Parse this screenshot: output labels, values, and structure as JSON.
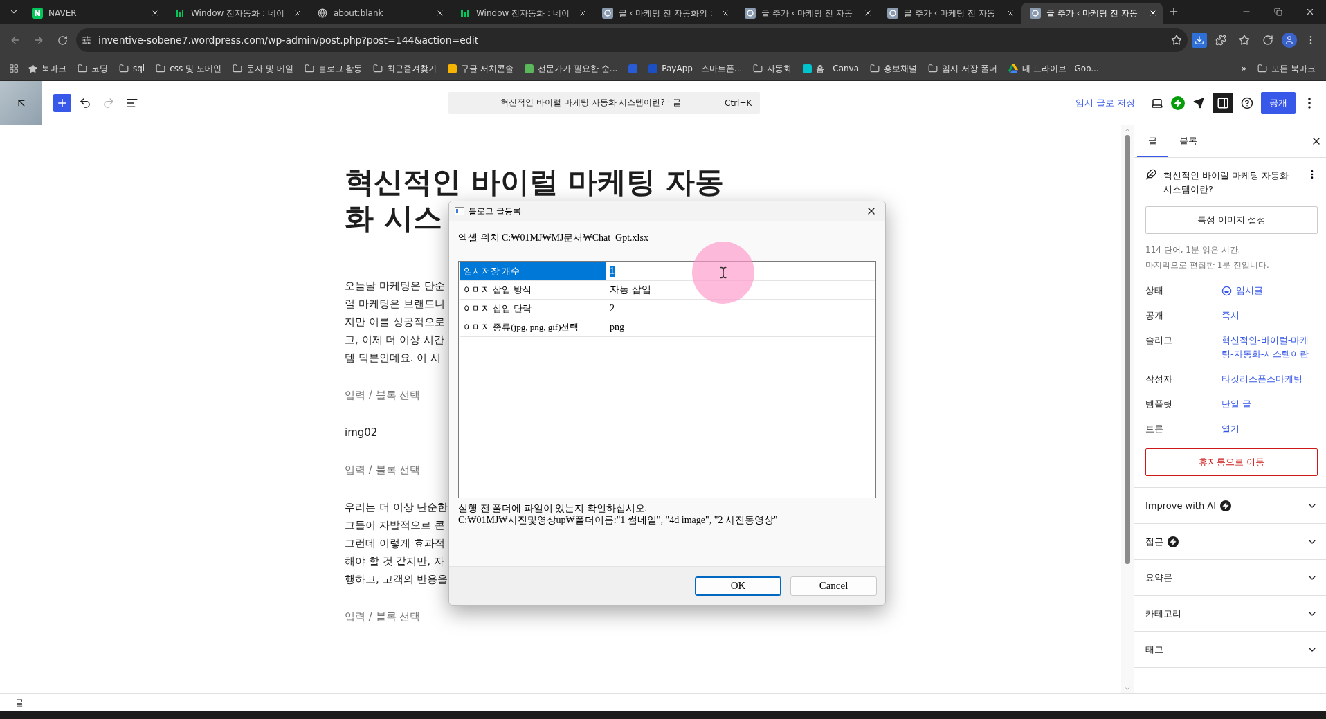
{
  "browser": {
    "tabs": [
      {
        "kind": "naver",
        "title": "NAVER",
        "selected": false
      },
      {
        "kind": "blog",
        "title": "Window 전자동화 : 네이",
        "selected": false
      },
      {
        "kind": "blank",
        "title": "about:blank",
        "selected": false
      },
      {
        "kind": "blog",
        "title": "Window 전자동화 : 네이",
        "selected": false
      },
      {
        "kind": "wordpress",
        "title": "글 ‹ 마케팅 전 자동화의 :",
        "selected": false
      },
      {
        "kind": "wordpress",
        "title": "글 추가 ‹ 마케팅 전 자동",
        "selected": false
      },
      {
        "kind": "wordpress",
        "title": "글 추가 ‹ 마케팅 전 자동",
        "selected": false
      },
      {
        "kind": "wordpress",
        "title": "글 추가 ‹ 마케팅 전 자동",
        "selected": true
      }
    ],
    "url": "inventive-sobene7.wordpress.com/wp-admin/post.php?post=144&action=edit",
    "bookmarks": [
      {
        "kind": "star",
        "label": "북마크"
      },
      {
        "kind": "folder",
        "label": "코딩"
      },
      {
        "kind": "folder",
        "label": "sql"
      },
      {
        "kind": "folder",
        "label": "css 및 도메인"
      },
      {
        "kind": "folder",
        "label": "문자 및 메일"
      },
      {
        "kind": "folder",
        "label": "블로그 활동"
      },
      {
        "kind": "folder",
        "label": "최근즐겨찾기"
      },
      {
        "kind": "site",
        "color": "#f4b400",
        "label": "구글 서치콘솔"
      },
      {
        "kind": "site",
        "color": "#5bb75b",
        "label": "전문가가 필요한 순..."
      },
      {
        "kind": "site",
        "color": "#2a5bd7"
      },
      {
        "kind": "site",
        "color": "#1d4fc4",
        "label": "PayApp - 스마트폰..."
      },
      {
        "kind": "folder",
        "label": "자동화"
      },
      {
        "kind": "site",
        "color": "#00c4cc",
        "label": "홈 - Canva"
      },
      {
        "kind": "folder",
        "label": "홍보채널"
      },
      {
        "kind": "folder",
        "label": "임시 저장 폴더"
      },
      {
        "kind": "drive",
        "label": "내 드라이브 - Goo..."
      }
    ],
    "more": "»",
    "all_bookmarks": "모든 북마크"
  },
  "toolbar": {
    "command": "혁신적인 바이럴 마케팅 자동화 시스템이란? · 글",
    "shortcut": "Ctrl+K",
    "save_draft": "임시 글로 저장",
    "publish": "공개",
    "redo_disabled": true,
    "sidebar_open": true
  },
  "editor": {
    "title_lines": [
      "혁신적인 바이럴 마케팅 자동",
      "화 시스"
    ],
    "blocks": [
      {
        "kind": "paragraph",
        "lines": [
          "오늘날 마케팅은 단순",
          "럴 마케팅은 브랜드니",
          "지만 이를 성공적으로",
          "고, 이제 더 이상 시간",
          "템 덕분인데요. 이 시"
        ]
      },
      {
        "kind": "placeholder",
        "text": "입력 / 블록 선택"
      },
      {
        "kind": "text",
        "text": "img02"
      },
      {
        "kind": "placeholder",
        "text": "입력 / 블록 선택"
      },
      {
        "kind": "paragraph",
        "lines": [
          "우리는 더 이상 단순한",
          "그들이 자발적으로 콘",
          "그런데 이렇게 효과적",
          "해야 할 것 같지만, 자",
          "행하고, 고객의 반응을"
        ]
      },
      {
        "kind": "placeholder",
        "text": "입력 / 블록 선택"
      }
    ]
  },
  "dialog": {
    "title": "블로그 글등록",
    "excel_path": "엑셀 위치 C:₩01MJ₩MJ문서₩Chat_Gpt.xlsx",
    "rows": [
      {
        "label": "임시저장 개수",
        "value": "1",
        "selected": true
      },
      {
        "label": "이미지 삽입 방식",
        "value": "자동 삽입",
        "selected": false
      },
      {
        "label": "이미지 삽입 단락",
        "value": "2",
        "selected": false
      },
      {
        "label": "이미지 종류(jpg, png, gif)선택",
        "value": "png",
        "selected": false
      }
    ],
    "notes": [
      "실행 전 폴더에 파일이 있는지 확인하십시오.",
      "C:₩01MJ₩사진및영상up₩폴더이름:\"1 썸네일\", \"4d image\", \"2 사진동영상\""
    ],
    "buttons": [
      {
        "label": "OK",
        "default": true
      },
      {
        "label": "Cancel",
        "default": false
      }
    ]
  },
  "sidebar": {
    "tabs": [
      {
        "label": "글",
        "selected": true
      },
      {
        "label": "블록",
        "selected": false
      }
    ],
    "post_title": "혁신적인 바이럴 마케팅 자동화 시스템이란?",
    "featured_image": "특성 이미지 설정",
    "stats": [
      "114 단어, 1분 읽은 시간.",
      "마지막으로 편집한 1분 전입니다."
    ],
    "fields": [
      {
        "kind": "status",
        "label": "상태",
        "value": "임시글"
      },
      {
        "kind": "link",
        "label": "공개",
        "value": "즉시"
      },
      {
        "kind": "link",
        "label": "슬러그",
        "value": "혁신적인-바이럴-마케팅-자동화-시스템이란"
      },
      {
        "kind": "link",
        "label": "작성자",
        "value": "타깃리스폰스마케팅"
      },
      {
        "kind": "link",
        "label": "템플릿",
        "value": "단일 글"
      },
      {
        "kind": "link",
        "label": "토론",
        "value": "열기"
      }
    ],
    "trash": "휴지통으로 이동",
    "panels": [
      {
        "label": "Improve with AI",
        "badge": true,
        "expanded": false
      },
      {
        "label": "접근",
        "badge": true,
        "expanded": false
      },
      {
        "label": "요약문",
        "badge": false,
        "expanded": false
      },
      {
        "label": "카테고리",
        "badge": false,
        "expanded": false
      },
      {
        "label": "태그",
        "badge": false,
        "expanded": false
      }
    ]
  },
  "status_bar": {
    "breadcrumb": "글"
  }
}
